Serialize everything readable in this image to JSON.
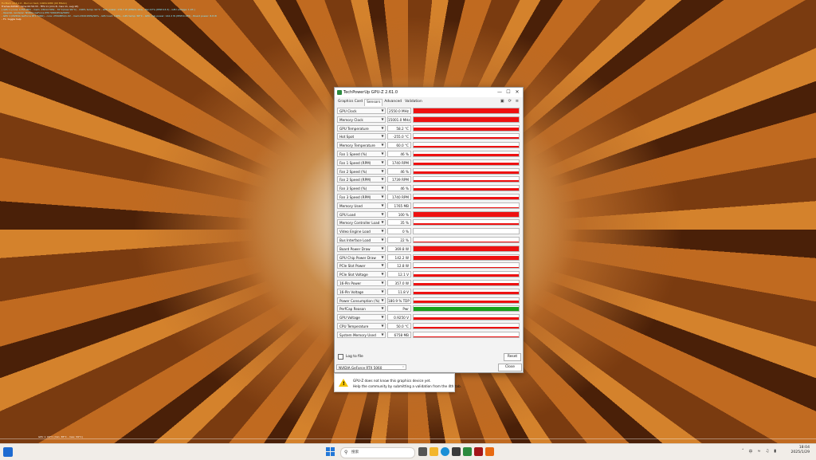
{
  "osd": {
    "lines": [
      "FurMark v2.6.1.0 - Burn-in test, 1920x1080 (0X MSAA)",
      "Frames:69340 - time:00:59:33 - FPS:11 (min:8, max:11, avg:18)",
      "[ GPU 1 (core: 1755 MHz - mem: 15012 MHz - 70°C(max:99°C) - 246% temp: 91°C - GPU power: 176.7 W (PPW:0.161) - Fan:97% (PPW:13.3) - GPU voltage: 1.03 ]",
      "- OpenGL renderer: NVIDIA GeForce RTX 5060/PCIe/SSE2",
      "- GPU 1 (NVIDIA GeForce RTX 5060) - core: 2550MHz/1.0V - mem:15001MHz/99% - GPU load: 100% - GPU temp: 58°C - GPU chip power: 142.2 W (PPW:0.185) - Board power: 8.8 W",
      "- F1: toggle help"
    ],
    "bottom_text": "GPU 1: 69°C (min: 38°C - max: 59°C)"
  },
  "window": {
    "title": "TechPowerUp GPU-Z 2.61.0",
    "controls": {
      "minimize": "—",
      "maximize": "☐",
      "close": "✕"
    },
    "tabs": [
      "Graphics Card",
      "Sensors",
      "Advanced",
      "Validation"
    ],
    "active_tab": "Sensors",
    "toolbar_icons": [
      "camera-icon",
      "refresh-icon",
      "menu-icon"
    ],
    "sensors": [
      {
        "label": "GPU Clock",
        "value": "2550.0 MHz",
        "level": 0.95,
        "color": "#ee1111"
      },
      {
        "label": "Memory Clock",
        "value": "15001.0 MHz",
        "level": 0.95,
        "color": "#ee1111"
      },
      {
        "label": "GPU Temperature",
        "value": "58.2 °C",
        "level": 0.6,
        "color": "#ee1111"
      },
      {
        "label": "Hot Spot",
        "value": "-255.0 °C",
        "level": 0.45,
        "color": "#ee1111"
      },
      {
        "label": "Memory Temperature",
        "value": "60.0 °C",
        "level": 0.45,
        "color": "#ee1111"
      },
      {
        "label": "Fan 1 Speed (%)",
        "value": "46 %",
        "level": 0.45,
        "color": "#ee1111"
      },
      {
        "label": "Fan 1 Speed (RPM)",
        "value": "1740 RPM",
        "level": 0.45,
        "color": "#ee1111"
      },
      {
        "label": "Fan 2 Speed (%)",
        "value": "46 %",
        "level": 0.45,
        "color": "#ee1111"
      },
      {
        "label": "Fan 2 Speed (RPM)",
        "value": "1739 RPM",
        "level": 0.45,
        "color": "#ee1111"
      },
      {
        "label": "Fan 3 Speed (%)",
        "value": "46 %",
        "level": 0.45,
        "color": "#ee1111"
      },
      {
        "label": "Fan 3 Speed (RPM)",
        "value": "1740 RPM",
        "level": 0.45,
        "color": "#ee1111"
      },
      {
        "label": "Memory Used",
        "value": "1765 MB",
        "level": 0.12,
        "color": "#ee1111"
      },
      {
        "label": "GPU Load",
        "value": "100 %",
        "level": 0.95,
        "color": "#ee1111"
      },
      {
        "label": "Memory Controller Load",
        "value": "35 %",
        "level": 0.4,
        "color": "#ee1111"
      },
      {
        "label": "Video Engine Load",
        "value": "0 %",
        "level": 0.0,
        "color": "#ee1111"
      },
      {
        "label": "Bus Interface Load",
        "value": "22 %",
        "level": 0.2,
        "color": "#ee1111"
      },
      {
        "label": "Board Power Draw",
        "value": "369.8 W",
        "level": 0.95,
        "color": "#ee1111"
      },
      {
        "label": "GPU Chip Power Draw",
        "value": "142.2 W",
        "level": 0.7,
        "color": "#ee1111"
      },
      {
        "label": "PCIe Slot Power",
        "value": "12.8 W",
        "level": 0.2,
        "color": "#ee1111"
      },
      {
        "label": "PCIe Slot Voltage",
        "value": "12.1 V",
        "level": 0.6,
        "color": "#ee1111"
      },
      {
        "label": "16-Pin Power",
        "value": "357.0 W",
        "level": 0.55,
        "color": "#ee1111"
      },
      {
        "label": "16-Pin Voltage",
        "value": "11.8 V",
        "level": 0.5,
        "color": "#ee1111"
      },
      {
        "label": "Power Consumption (%)",
        "value": "180.9 % TDP",
        "level": 0.5,
        "color": "#ee1111"
      },
      {
        "label": "PerfCap Reason",
        "value": "Pwr",
        "level": 0.95,
        "color": "#19a019"
      },
      {
        "label": "GPU Voltage",
        "value": "0.9250 V",
        "level": 0.45,
        "color": "#ee1111"
      },
      {
        "label": "CPU Temperature",
        "value": "50.0 °C",
        "level": 0.3,
        "color": "#ee1111"
      },
      {
        "label": "System Memory Used",
        "value": "6758 MB",
        "level": 0.2,
        "color": "#ee1111"
      }
    ],
    "log_to_file": "Log to file",
    "reset": "Reset",
    "gpu_select": "NVIDIA GeForce RTX 5060",
    "close": "Close"
  },
  "notice": {
    "line1": "GPU-Z does not know this graphics device yet.",
    "line2": "Help the community by submitting a validation from the 4th tab."
  },
  "taskbar": {
    "search_placeholder": "搜索",
    "time": "18:04",
    "date": "2025/1/29",
    "ime": "中",
    "tray_icons": [
      "chevron-up-icon",
      "wifi-icon",
      "volume-icon",
      "battery-icon"
    ]
  }
}
